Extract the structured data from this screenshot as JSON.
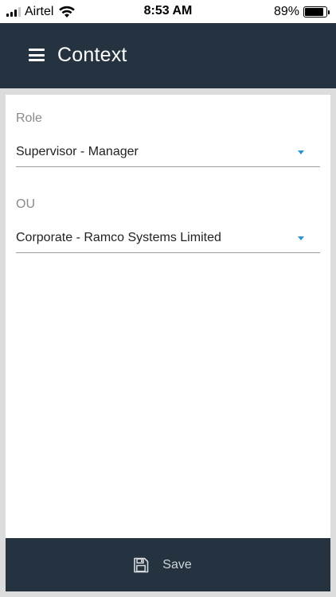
{
  "status_bar": {
    "carrier": "Airtel",
    "time": "8:53 AM",
    "battery_percent": "89%",
    "battery_level": 0.89,
    "signal_bars": 3,
    "signal_total": 4
  },
  "app_bar": {
    "title": "Context",
    "menu_icon": "hamburger-menu-icon"
  },
  "form": {
    "role": {
      "label": "Role",
      "value": "Supervisor - Manager"
    },
    "ou": {
      "label": "OU",
      "value": "Corporate - Ramco Systems Limited"
    }
  },
  "footer": {
    "save_label": "Save",
    "save_icon": "floppy-disk-icon"
  },
  "colors": {
    "header_bg": "#253341",
    "accent": "#2a93d5",
    "frame_bg": "#dcdcdc"
  }
}
